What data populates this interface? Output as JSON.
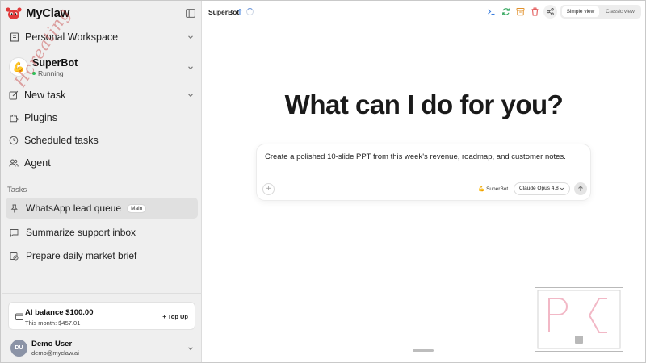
{
  "brand": {
    "name": "MyClaw"
  },
  "workspace": {
    "label": "Personal Workspace"
  },
  "bot": {
    "emoji": "💪",
    "name": "SuperBot",
    "status": "Running"
  },
  "nav": {
    "new_task": "New task",
    "plugins": "Plugins",
    "scheduled": "Scheduled tasks",
    "agent": "Agent"
  },
  "tasks": {
    "heading": "Tasks",
    "items": [
      {
        "label": "WhatsApp lead queue",
        "badge": "Main"
      },
      {
        "label": "Summarize support inbox"
      },
      {
        "label": "Prepare daily market brief"
      }
    ]
  },
  "balance": {
    "title": "AI balance $100.00",
    "month": "This month: $457.01",
    "topup": "+ Top Up"
  },
  "user": {
    "initials": "DU",
    "name": "Demo User",
    "email": "demo@myclaw.ai"
  },
  "topbar": {
    "bot_tab": "SuperBot",
    "view_simple": "Simple view",
    "view_classic": "Classic view"
  },
  "main": {
    "hero": "What can I do for you?",
    "composer_text": "Create a polished 10-slide PPT from this week's revenue, roadmap, and customer notes.",
    "composer_bot": "SuperBot",
    "model": "Claude Opus 4.8"
  },
  "colors": {
    "accent_blue": "#3b7ddd",
    "running_green": "#2fbf5a",
    "icon_green": "#2fa55a",
    "icon_orange": "#e0902a",
    "icon_red": "#e04848",
    "brand_red": "#e03a3a"
  },
  "icons": {
    "brand": "claw-mascot-icon",
    "workspace": "building-icon",
    "new_task": "edit-icon",
    "plugins": "puzzle-icon",
    "scheduled": "clock-icon",
    "agent": "users-icon",
    "pinned_task": "pin-icon",
    "chat_task": "chat-icon",
    "scheduled_task": "calendar-clock-icon",
    "balance": "wallet-icon",
    "terminal": "terminal-icon",
    "refresh": "refresh-icon",
    "archive": "archive-icon",
    "delete": "trash-icon",
    "share": "share-icon",
    "send": "arrow-up-icon"
  }
}
